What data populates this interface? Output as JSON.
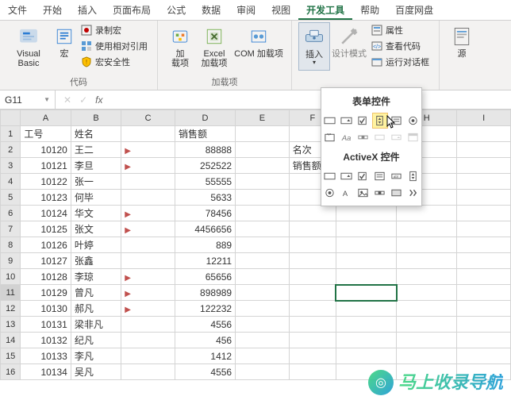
{
  "tabs": [
    "文件",
    "开始",
    "插入",
    "页面布局",
    "公式",
    "数据",
    "审阅",
    "视图",
    "开发工具",
    "帮助",
    "百度网盘"
  ],
  "activeTab": 8,
  "ribbon": {
    "group_code": {
      "vb": "Visual Basic",
      "macro": "宏",
      "rec": "录制宏",
      "relref": "使用相对引用",
      "sec": "宏安全性",
      "title": "代码"
    },
    "group_addin": {
      "addin": "加\n载项",
      "excel": "Excel\n加载项",
      "com": "COM 加载项",
      "title": "加载项"
    },
    "group_ctrl": {
      "insert": "插入",
      "design": "设计模式",
      "props": "属性",
      "view": "查看代码",
      "dlg": "运行对话框"
    },
    "group_src": {
      "src": "源"
    }
  },
  "namebox": "G11",
  "formula": "",
  "cols": [
    "A",
    "B",
    "C",
    "D",
    "E",
    "F",
    "G",
    "H",
    "I"
  ],
  "headerRow": {
    "a": "工号",
    "b": "姓名",
    "d": "销售额"
  },
  "sideLabels": {
    "f_rank": "名次",
    "f_sales": "销售额"
  },
  "rows": [
    {
      "n": 2,
      "id": 10120,
      "name": "王二",
      "flag": true,
      "sales": 88888
    },
    {
      "n": 3,
      "id": 10121,
      "name": "李旦",
      "flag": true,
      "sales": 252522
    },
    {
      "n": 4,
      "id": 10122,
      "name": "张一",
      "flag": false,
      "sales": 55555
    },
    {
      "n": 5,
      "id": 10123,
      "name": "何毕",
      "flag": false,
      "sales": 5633
    },
    {
      "n": 6,
      "id": 10124,
      "name": "华文",
      "flag": true,
      "sales": 78456
    },
    {
      "n": 7,
      "id": 10125,
      "name": "张文",
      "flag": true,
      "sales": 4456656
    },
    {
      "n": 8,
      "id": 10126,
      "name": "叶婷",
      "flag": false,
      "sales": 889
    },
    {
      "n": 9,
      "id": 10127,
      "name": "张鑫",
      "flag": false,
      "sales": 12211
    },
    {
      "n": 10,
      "id": 10128,
      "name": "李琼",
      "flag": true,
      "sales": 65656
    },
    {
      "n": 11,
      "id": 10129,
      "name": "曾凡",
      "flag": true,
      "sales": 898989
    },
    {
      "n": 12,
      "id": 10130,
      "name": "郝凡",
      "flag": true,
      "sales": 122232
    },
    {
      "n": 13,
      "id": 10131,
      "name": "梁非凡",
      "flag": false,
      "sales": 4556
    },
    {
      "n": 14,
      "id": 10132,
      "name": "纪凡",
      "flag": false,
      "sales": 456
    },
    {
      "n": 15,
      "id": 10133,
      "name": "李凡",
      "flag": false,
      "sales": 1412
    },
    {
      "n": 16,
      "id": 10134,
      "name": "吴凡",
      "flag": false,
      "sales": 4556
    }
  ],
  "popup": {
    "form_title": "表单控件",
    "activex_title": "ActiveX 控件"
  },
  "watermark": "马上收录导航",
  "selected": {
    "row": 11,
    "col": "G"
  }
}
